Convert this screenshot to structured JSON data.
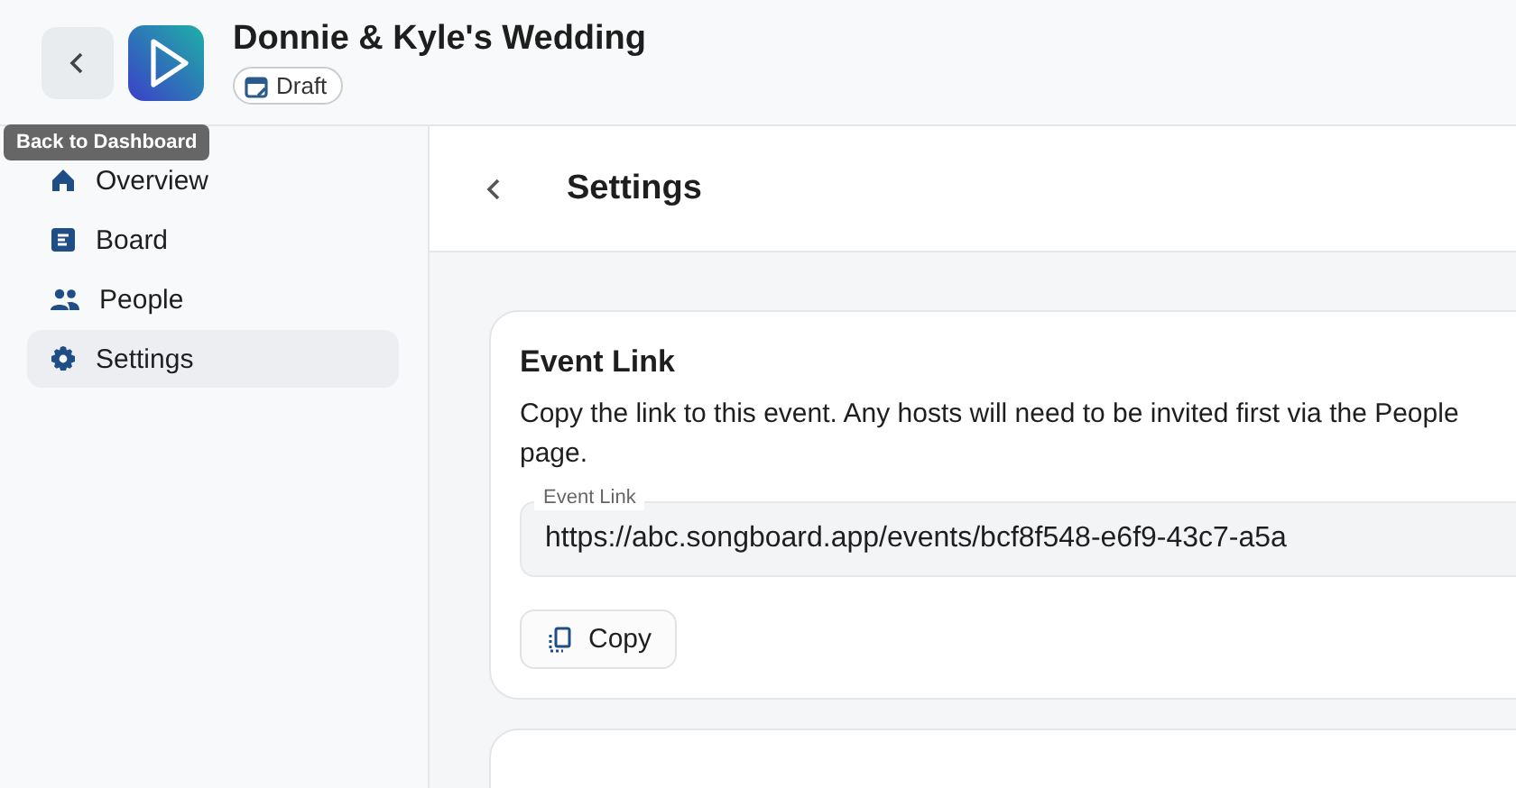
{
  "header": {
    "title": "Donnie & Kyle's Wedding",
    "status_badge": "Draft",
    "tooltip": "Back to Dashboard"
  },
  "sidebar": {
    "items": [
      {
        "label": "Overview",
        "kind": "home",
        "selected": false
      },
      {
        "label": "Board",
        "kind": "board",
        "selected": false
      },
      {
        "label": "People",
        "kind": "people",
        "selected": false
      },
      {
        "label": "Settings",
        "kind": "gear",
        "selected": true
      }
    ]
  },
  "page": {
    "title": "Settings"
  },
  "event_link_card": {
    "title": "Event Link",
    "description": "Copy the link to this event. Any hosts will need to be invited first via the People page.",
    "field_label": "Event Link",
    "field_value": "https://abc.songboard.app/events/bcf8f548-e6f9-43c7-a5a",
    "copy_button": "Copy"
  }
}
